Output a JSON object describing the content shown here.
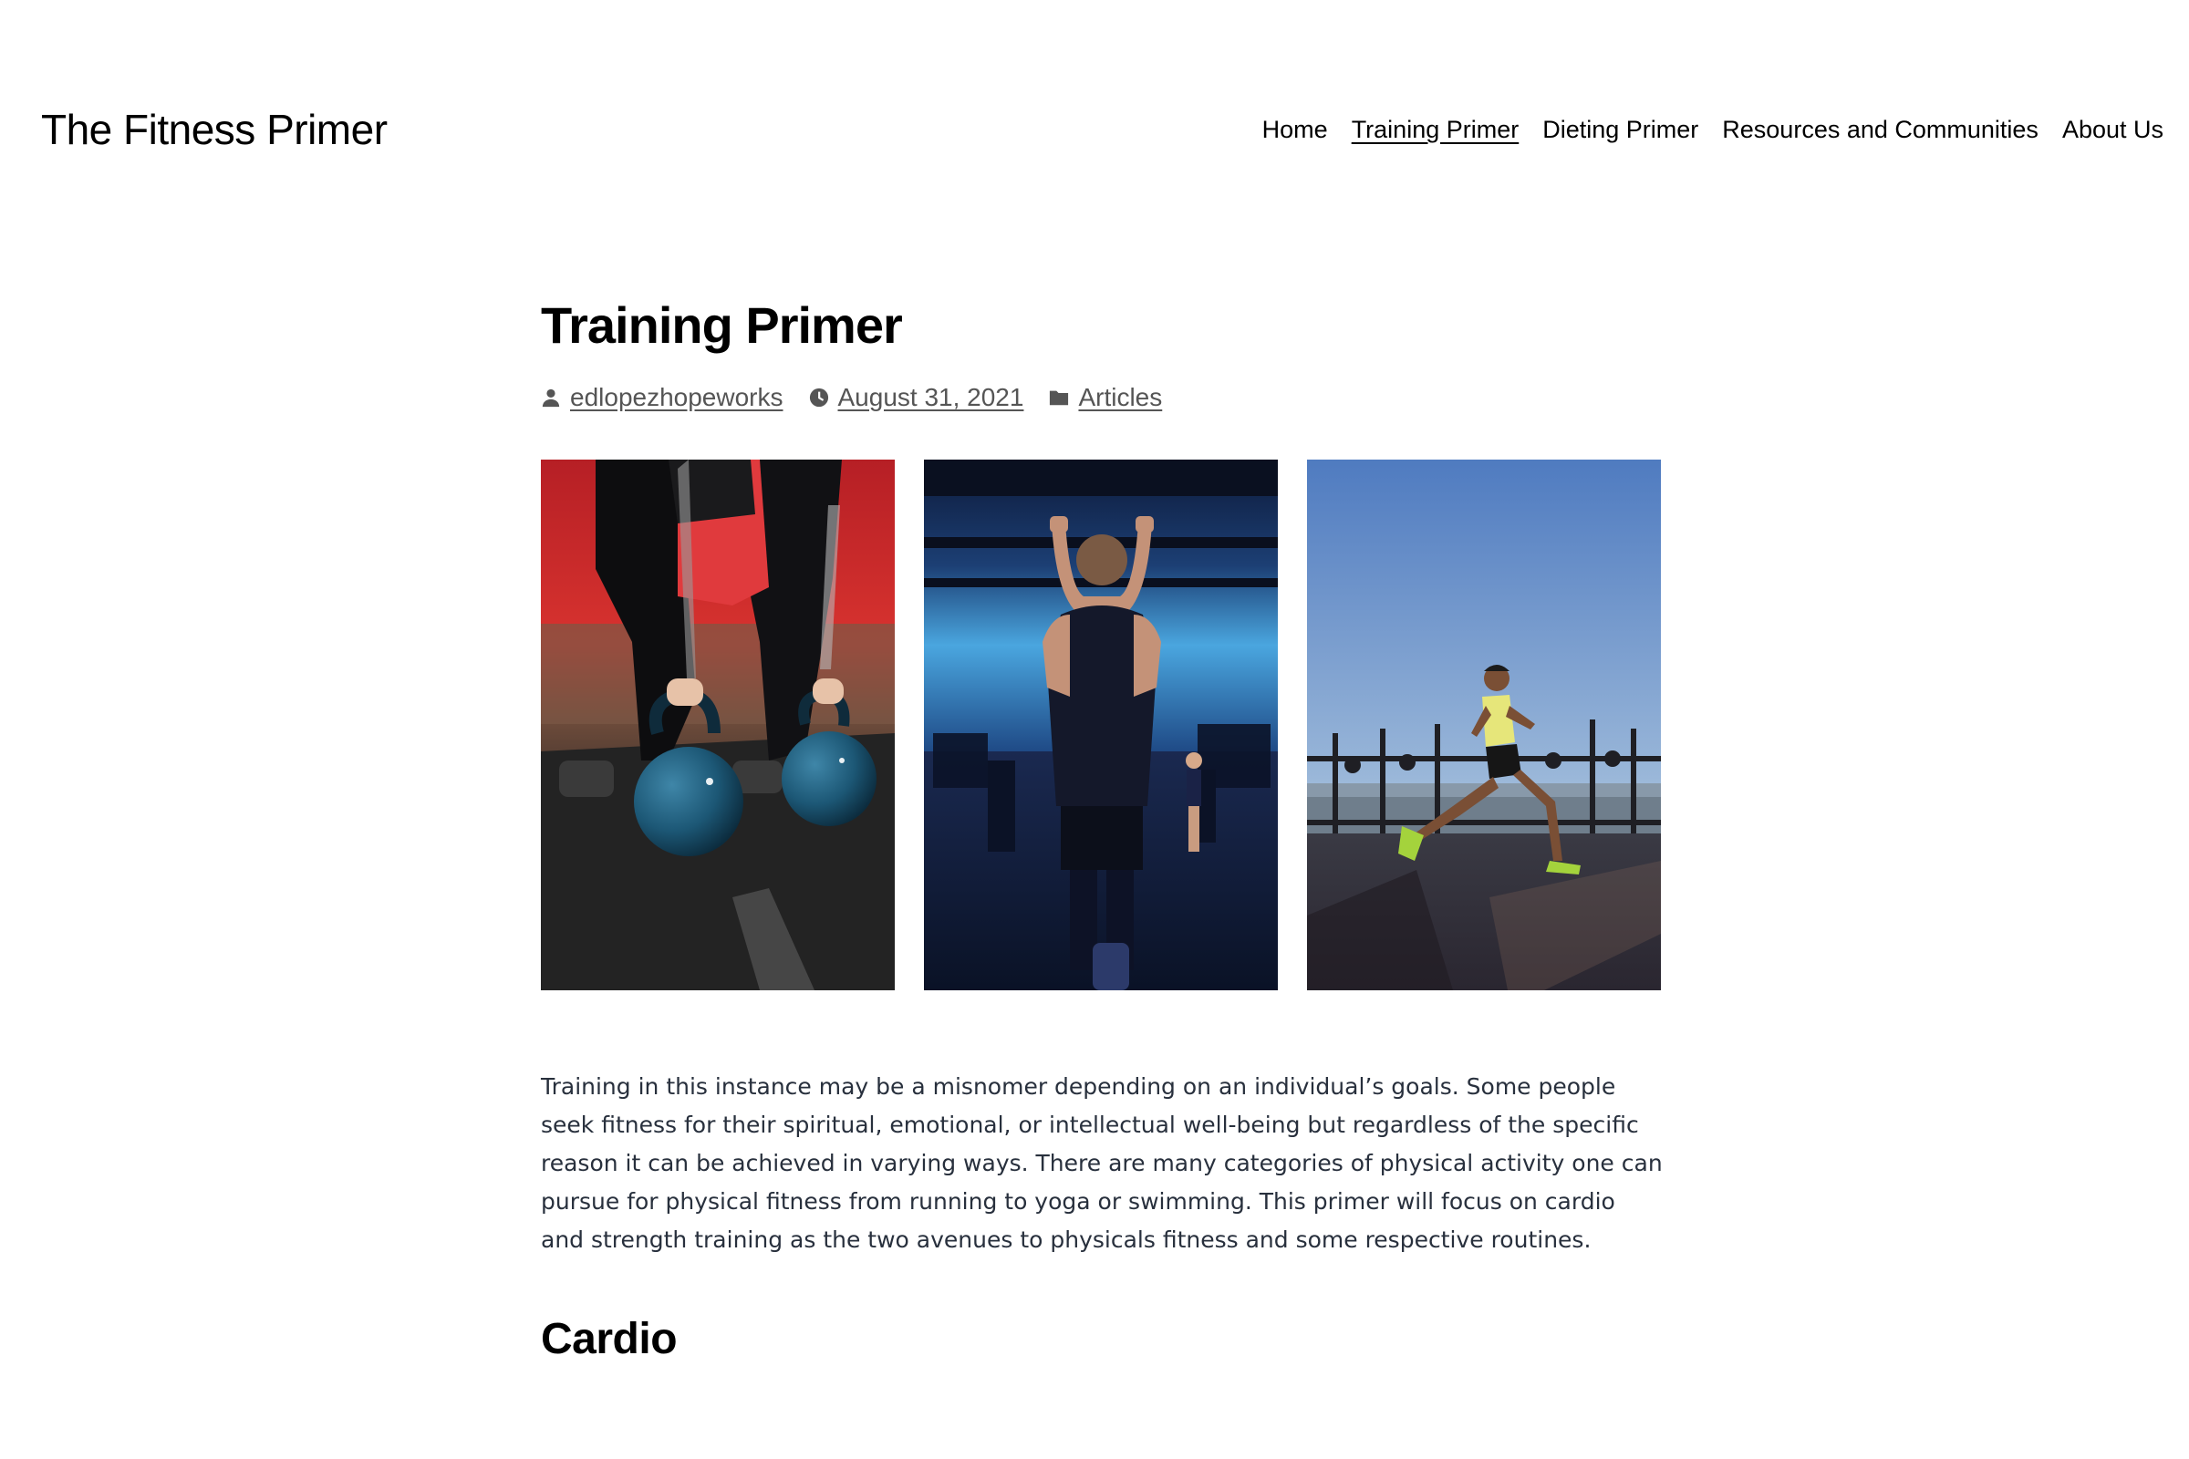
{
  "site": {
    "title": "The Fitness Primer"
  },
  "nav": {
    "items": [
      {
        "label": "Home",
        "current": false
      },
      {
        "label": "Training Primer",
        "current": true
      },
      {
        "label": "Dieting Primer",
        "current": false
      },
      {
        "label": "Resources and Communities",
        "current": false
      },
      {
        "label": "About Us",
        "current": false
      }
    ]
  },
  "post": {
    "title": "Training Primer",
    "meta": {
      "author": "edlopezhopeworks",
      "date": "August 31, 2021",
      "category": "Articles"
    },
    "gallery": [
      {
        "subject": "kettlebell-lift"
      },
      {
        "subject": "pull-up"
      },
      {
        "subject": "runner"
      }
    ],
    "body": "Training in this instance may be a misnomer depending on an individual’s goals. Some people seek fitness for their spiritual, emotional, or intellectual well-being but regardless of the specific reason it can be achieved in varying ways. There are many categories of physical activity one can pursue for physical fitness from running to yoga or swimming. This primer will focus on cardio and strength training as the two avenues to physicals fitness and some respective routines.",
    "section_heading": "Cardio"
  },
  "colors": {
    "text": "#000000",
    "meta": "#555555",
    "body": "#28303d",
    "background": "#ffffff"
  }
}
